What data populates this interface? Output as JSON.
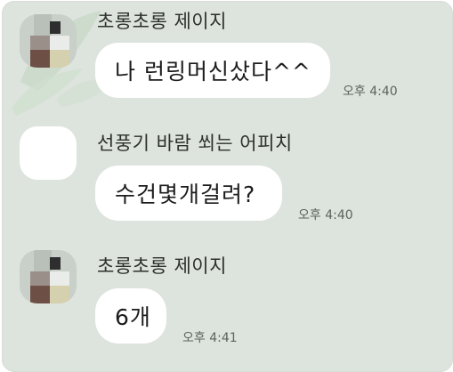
{
  "chat": {
    "messages": [
      {
        "sender": "초롱초롱 제이지",
        "text": "나 런링머신샀다^^",
        "time": "오후 4:40"
      },
      {
        "sender": "선풍기 바람 쐬는 어피치",
        "text": "수건몇개걸려?",
        "time": "오후 4:40"
      },
      {
        "sender": "초롱초롱 제이지",
        "text": "6개",
        "time": "오후 4:41"
      }
    ]
  },
  "colors": {
    "background": "#dde3dd",
    "bubble": "#ffffff",
    "text": "#1c1c1c"
  }
}
